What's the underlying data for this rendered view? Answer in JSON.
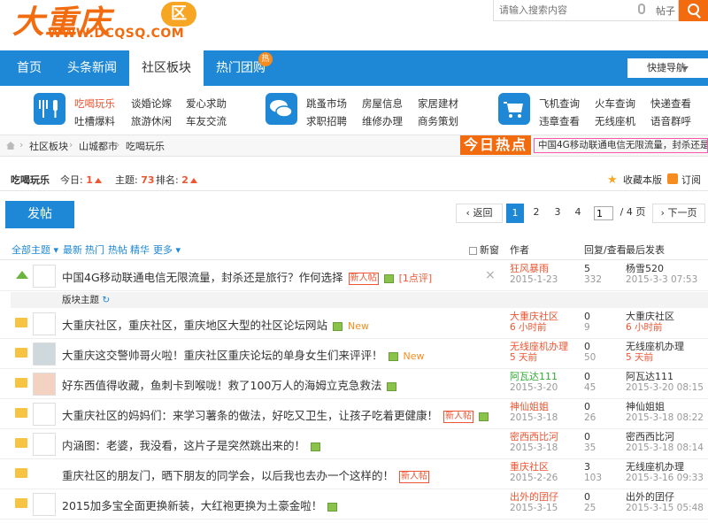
{
  "logo": {
    "cn": "大重庆",
    "qu": "区",
    "url": "WWW.DCQSQ.COM"
  },
  "search": {
    "placeholder": "请输入搜索内容",
    "type": "帖子"
  },
  "nav": {
    "items": [
      "首页",
      "头条新闻",
      "社区板块",
      "热门团购"
    ],
    "badge": "热",
    "quick": "快捷导航"
  },
  "cats": [
    {
      "links": [
        "吃喝玩乐",
        "谈婚论嫁",
        "爱心求助",
        "吐槽爆料",
        "旅游休闲",
        "车友交流"
      ]
    },
    {
      "links": [
        "跳蚤市场",
        "房屋信息",
        "家居建材",
        "求职招聘",
        "维修办理",
        "商务策划"
      ]
    },
    {
      "links": [
        "飞机查询",
        "火车查询",
        "快递查看",
        "违章查看",
        "无线座机",
        "语音群呼"
      ]
    }
  ],
  "crumb": [
    "社区板块",
    "山城都市",
    "吃喝玩乐"
  ],
  "today_hot": "今日热点",
  "ticker": "中国4G移动联通电信无限流量，封杀还是",
  "forum": {
    "name": "吃喝玩乐",
    "today_label": "今日:",
    "today": "1",
    "topics_label": "主题:",
    "topics": "73",
    "rank_label": "排名:",
    "rank": "2",
    "fav": "收藏本版",
    "rss": "订阅"
  },
  "post_button": "发帖",
  "pager": {
    "back": "返回",
    "pages": [
      "1",
      "2",
      "3",
      "4"
    ],
    "current": "1",
    "total": "/ 4 页",
    "next": "下一页"
  },
  "filters": [
    "全部主题",
    "最新",
    "热门",
    "热帖",
    "精华",
    "更多"
  ],
  "columns": {
    "new": "新窗",
    "author": "作者",
    "reply": "回复/查看",
    "last": "最后发表"
  },
  "section_label": "版块主题",
  "rows": [
    {
      "title": "中国4G移动联通电信无限流量，封杀还是旅行？作何选择",
      "tag": "新人帖",
      "extra": "[1点评]",
      "author": "狂风暴雨",
      "date": "2015-1-23",
      "replies": "5",
      "views": "332",
      "last_user": "杨雪520",
      "last_date": "2015-3-3 07:53"
    },
    {
      "title": "大重庆社区，重庆社区，重庆地区大型的社区论坛网站",
      "new": "New",
      "author": "大重庆社区",
      "date": "6 小时前",
      "replies": "0",
      "views": "9",
      "last_user": "大重庆社区",
      "last_date": "6 小时前"
    },
    {
      "title": "大重庆这交警帅哥火啦！重庆社区重庆论坛的单身女生们来评评！",
      "new": "New",
      "author": "无线座机办理",
      "date": "5 天前",
      "replies": "0",
      "views": "50",
      "last_user": "无线座机办理",
      "last_date": "5 天前"
    },
    {
      "title": "好东西值得收藏，鱼刺卡到喉咙！救了100万人的海姆立克急救法",
      "author": "阿瓦达111",
      "date": "2015-3-20",
      "replies": "0",
      "views": "45",
      "last_user": "阿瓦达111",
      "last_date": "2015-3-20 08:15"
    },
    {
      "title": "大重庆社区的妈妈们：来学习薯条的做法，好吃又卫生，让孩子吃着更健康！",
      "tag": "新人帖",
      "author": "神仙姐姐",
      "date": "2015-3-18",
      "replies": "0",
      "views": "26",
      "last_user": "神仙姐姐",
      "last_date": "2015-3-18 08:22"
    },
    {
      "title": "内涵图：老婆，我没看，这片子是突然跳出来的！",
      "author": "密西西比河",
      "date": "2015-3-18",
      "replies": "0",
      "views": "35",
      "last_user": "密西西比河",
      "last_date": "2015-3-18 08:14"
    },
    {
      "title": "重庆社区的朋友门，晒下朋友的同学会，以后我也去办一个这样的！",
      "tag": "新人帖",
      "author": "重庆社区",
      "date": "2015-2-26",
      "replies": "3",
      "views": "103",
      "last_user": "无线座机办理",
      "last_date": "2015-3-16 09:33"
    },
    {
      "title": "2015加多宝全面更换新装，大红袍更换为土豪金啦！",
      "author": "出外的囝仔",
      "date": "2015-3-15",
      "replies": "0",
      "views": "25",
      "last_user": "出外的囝仔",
      "last_date": "2015-3-15 05:48"
    }
  ]
}
